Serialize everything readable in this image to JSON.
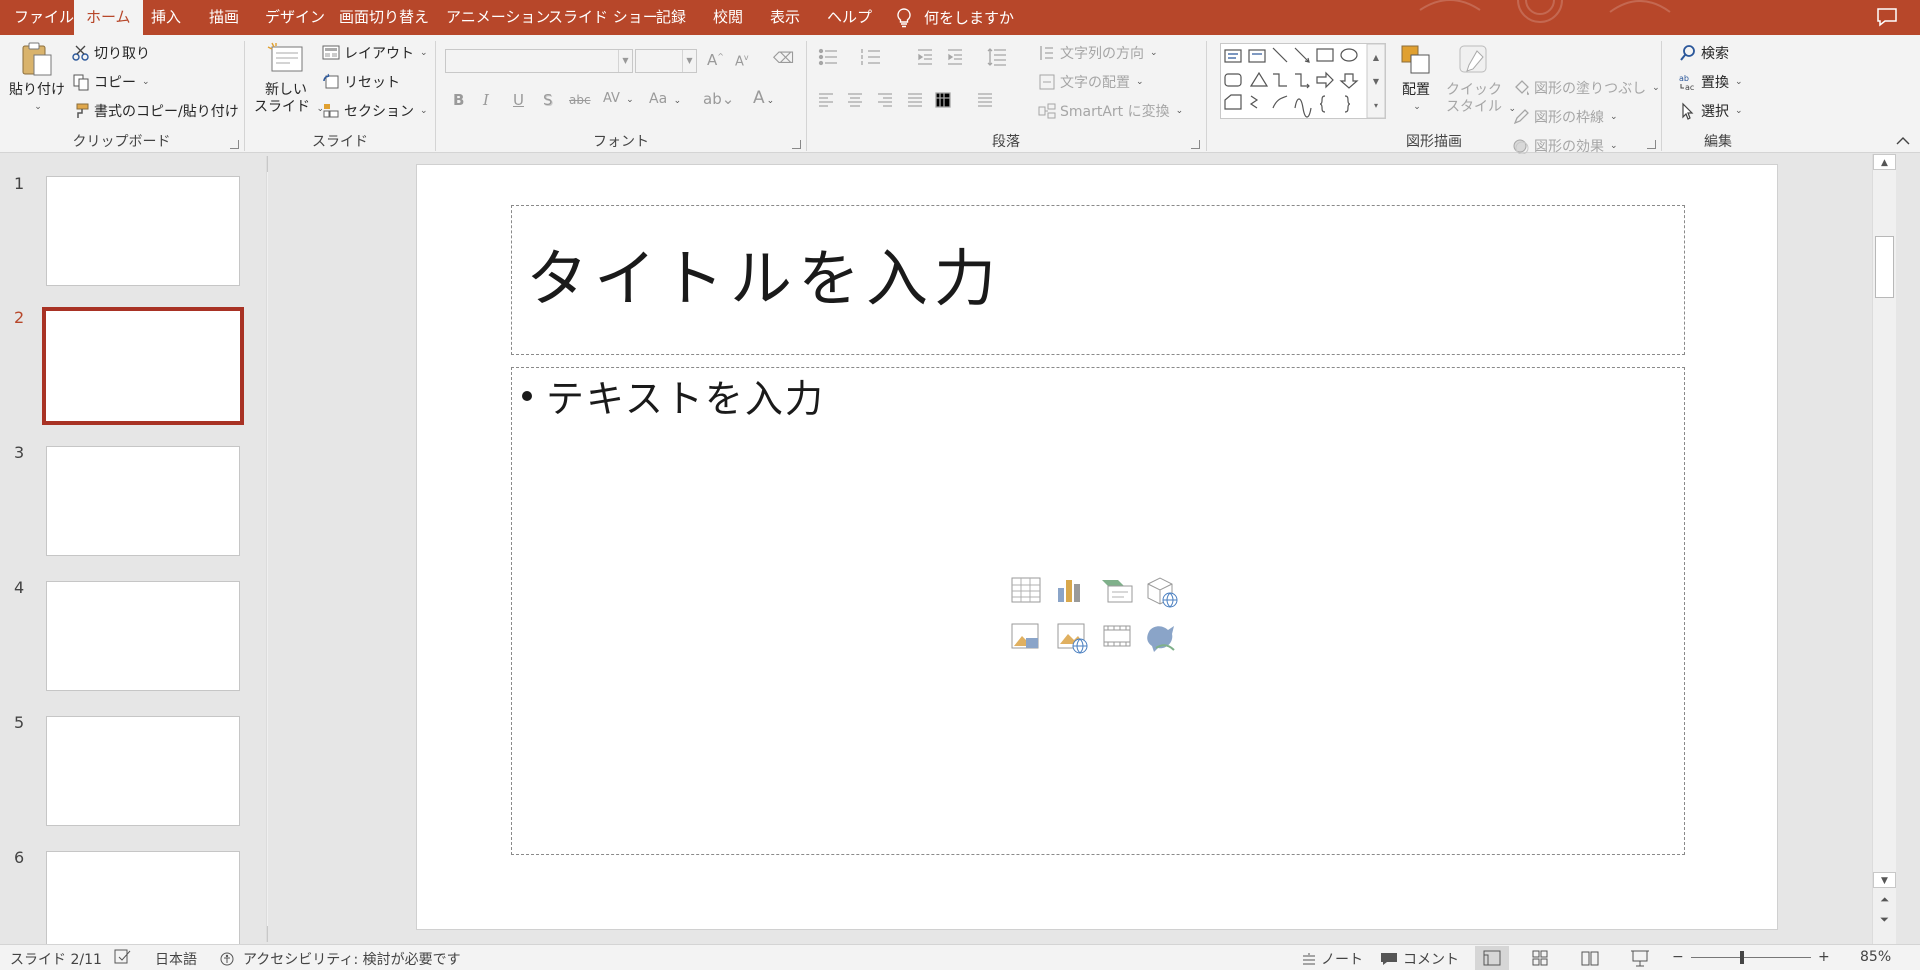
{
  "tabs": [
    "ファイル",
    "ホーム",
    "挿入",
    "描画",
    "デザイン",
    "画面切り替え",
    "アニメーション",
    "スライド ショー",
    "記録",
    "校閲",
    "表示",
    "ヘルプ"
  ],
  "tell_me": "何をしますか",
  "clipboard": {
    "paste": "貼り付け",
    "cut": "切り取り",
    "copy": "コピー",
    "format_painter": "書式のコピー/貼り付け",
    "label": "クリップボード"
  },
  "slides_group": {
    "new_slide_line1": "新しい",
    "new_slide_line2": "スライド",
    "layout": "レイアウト",
    "reset": "リセット",
    "section": "セクション",
    "label": "スライド"
  },
  "font_group": {
    "font_name": "",
    "font_size": "",
    "bold": "B",
    "italic": "I",
    "underline": "U",
    "shadow": "S",
    "strike": "abc",
    "spacing": "AV",
    "case": "Aa",
    "label": "フォント"
  },
  "paragraph_group": {
    "text_direction": "文字列の方向",
    "align_text": "文字の配置",
    "smartart": "SmartArt に変換",
    "label": "段落"
  },
  "drawing_group": {
    "arrange": "配置",
    "quick_styles_line1": "クイック",
    "quick_styles_line2": "スタイル",
    "shape_fill": "図形の塗りつぶし",
    "shape_outline": "図形の枠線",
    "shape_effects": "図形の効果",
    "label": "図形描画"
  },
  "editing_group": {
    "find": "検索",
    "replace": "置換",
    "select": "選択",
    "label": "編集"
  },
  "thumbnails": {
    "numbers": [
      "1",
      "2",
      "3",
      "4",
      "5",
      "6"
    ],
    "selected": "2"
  },
  "slide": {
    "title_placeholder": "タイトルを入力",
    "body_placeholder": "テキストを入力"
  },
  "status": {
    "slide_counter": "スライド 2/11",
    "language": "日本語",
    "accessibility": "アクセシビリティ: 検討が必要です",
    "notes": "ノート",
    "comments": "コメント",
    "zoom_minus": "−",
    "zoom_plus": "+",
    "zoom": "85%"
  },
  "colors": {
    "accent": "#b7472a",
    "selected_thumb_border": "#a83224",
    "ribbon_bg": "#f3f3f3",
    "workspace_bg": "#e6e6e6"
  }
}
